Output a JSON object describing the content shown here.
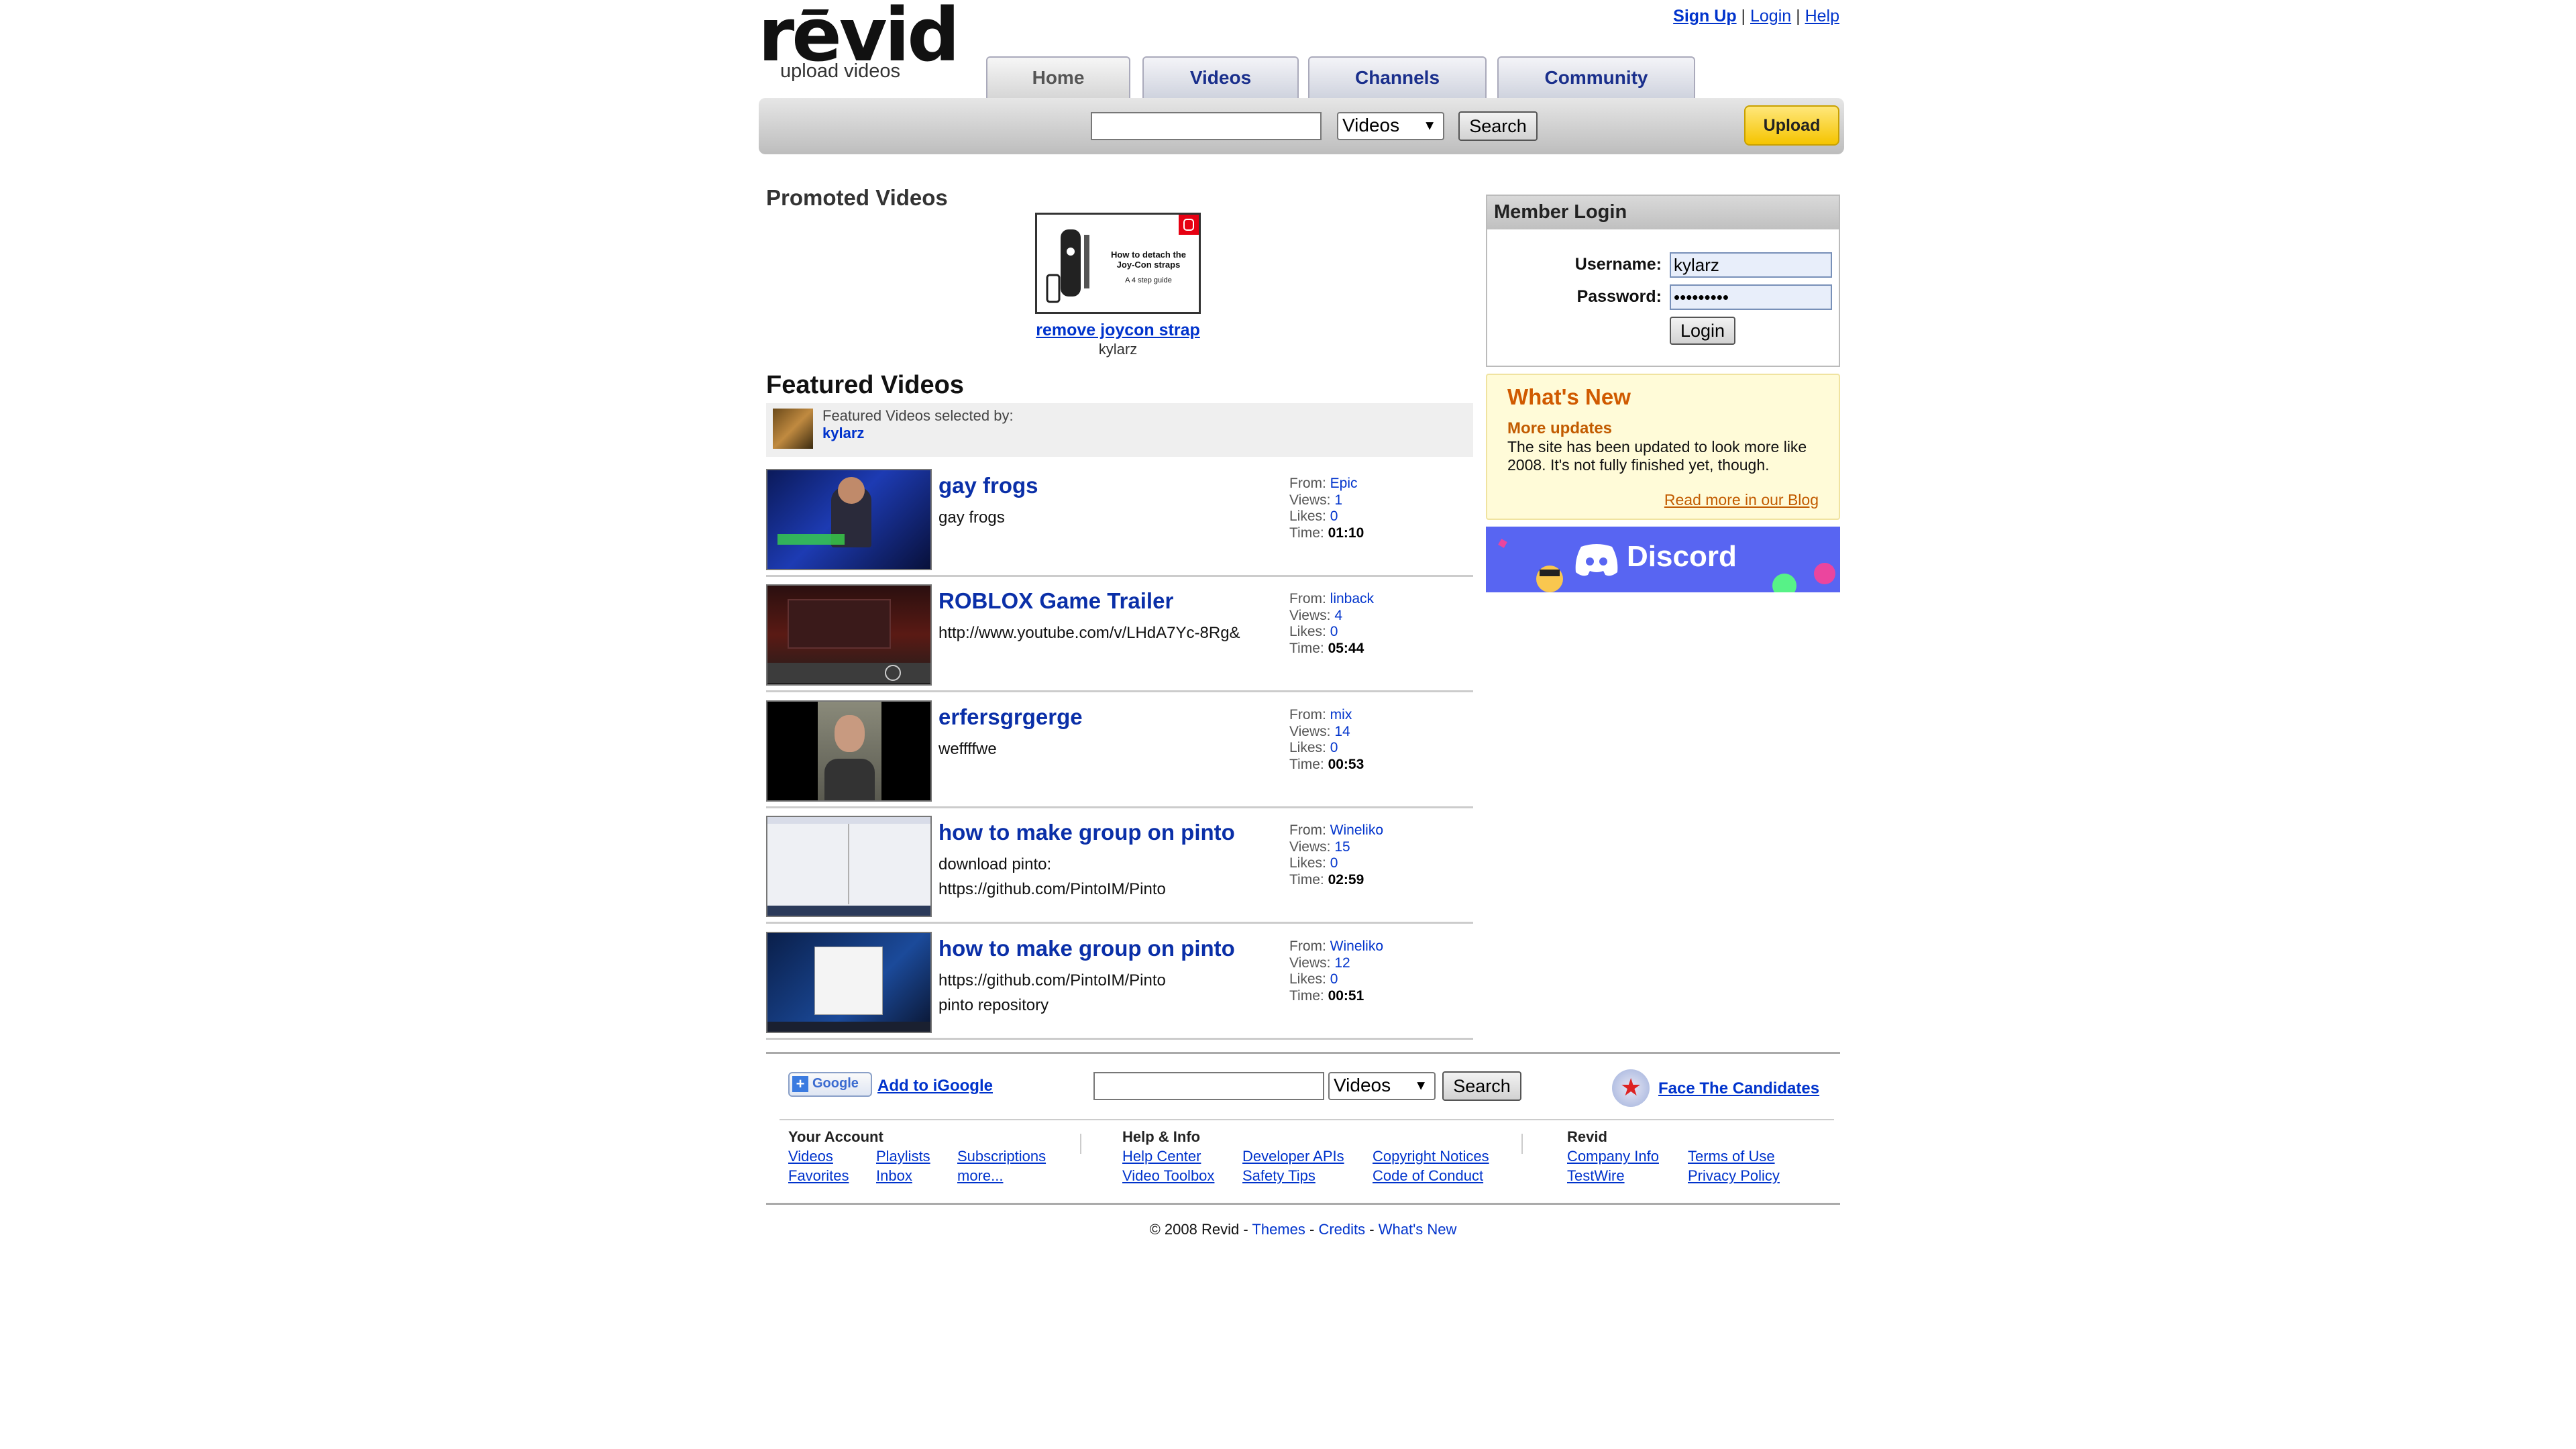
{
  "header": {
    "logo": "revid",
    "tagline": "upload videos",
    "signup": "Sign Up",
    "login": "Login",
    "help": "Help",
    "sep": "|"
  },
  "tabs": [
    "Home",
    "Videos",
    "Channels",
    "Community"
  ],
  "search": {
    "query": "",
    "category": "Videos",
    "button": "Search",
    "upload": "Upload"
  },
  "promoted": {
    "heading": "Promoted Videos",
    "thumb_text": "How to detach the Joy-Con straps",
    "thumb_subtext": "A 4 step guide",
    "title": "remove joycon strap",
    "user": "kylarz"
  },
  "featured": {
    "heading": "Featured Videos",
    "selected_by_label": "Featured Videos selected by:",
    "selected_by_user": "kylarz",
    "from_label": "From:",
    "views_label": "Views:",
    "likes_label": "Likes:",
    "time_label": "Time:",
    "videos": [
      {
        "title": "gay frogs",
        "desc1": "gay frogs",
        "desc2": "",
        "from": "Epic",
        "views": "1",
        "likes": "0",
        "time": "01:10"
      },
      {
        "title": "ROBLOX Game Trailer",
        "desc1": "http://www.youtube.com/v/LHdA7Yc-8Rg&",
        "desc2": "",
        "from": "linback",
        "views": "4",
        "likes": "0",
        "time": "05:44"
      },
      {
        "title": "erfersgrgerge",
        "desc1": "weffffwe",
        "desc2": "",
        "from": "mix",
        "views": "14",
        "likes": "0",
        "time": "00:53"
      },
      {
        "title": "how to make group on pinto",
        "desc1": "download pinto:",
        "desc2": "https://github.com/PintoIM/Pinto",
        "from": "Wineliko",
        "views": "15",
        "likes": "0",
        "time": "02:59"
      },
      {
        "title": "how to make group on pinto",
        "desc1": "https://github.com/PintoIM/Pinto",
        "desc2": "pinto repository",
        "from": "Wineliko",
        "views": "12",
        "likes": "0",
        "time": "00:51"
      }
    ]
  },
  "member_login": {
    "heading": "Member Login",
    "username_label": "Username:",
    "username_value": "kylarz",
    "password_label": "Password:",
    "password_value": "•••••••••",
    "button": "Login"
  },
  "whats_new": {
    "heading": "What's New",
    "subheading": "More updates",
    "text": "The site has been updated to look more like 2008. It's not fully finished yet, though.",
    "link": "Read more in our Blog"
  },
  "discord": {
    "label": "Discord"
  },
  "footer": {
    "igoogle_btn": "Google",
    "igoogle_link": "Add to iGoogle",
    "search_category": "Videos",
    "search_button": "Search",
    "candidates": "Face The Candidates",
    "your_account": {
      "heading": "Your Account",
      "links": [
        "Videos",
        "Favorites",
        "Playlists",
        "Inbox",
        "Subscriptions",
        "more..."
      ]
    },
    "help_info": {
      "heading": "Help & Info",
      "links": [
        "Help Center",
        "Video Toolbox",
        "Developer APIs",
        "Safety Tips",
        "Copyright Notices",
        "Code of Conduct"
      ]
    },
    "revid": {
      "heading": "Revid",
      "links": [
        "Company Info",
        "TestWire",
        "Terms of Use",
        "Privacy Policy"
      ]
    },
    "copyright": "© 2008 Revid -",
    "themes": "Themes",
    "credits": "Credits",
    "whats_new": "What's New",
    "dash": "-"
  },
  "colors": {
    "link": "#0033cc",
    "title": "#0a2fa8",
    "accent": "#d05a00",
    "upload": "#f5c400",
    "discord": "#5865f2"
  }
}
